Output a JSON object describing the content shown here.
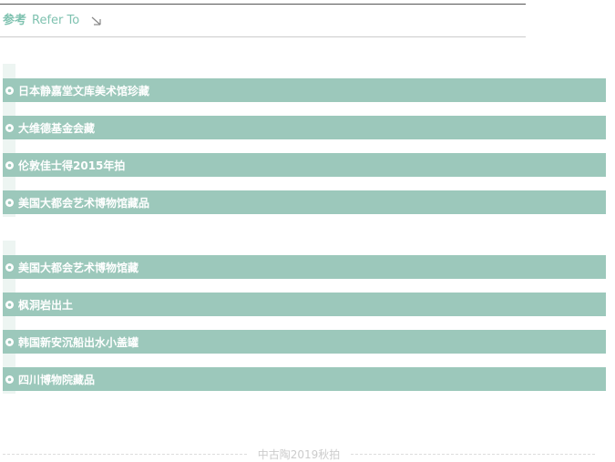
{
  "header": {
    "title_cn": "参考",
    "title_en": "Refer To",
    "accent": "#7fc2b0",
    "arrow_icon": "arrow-down-right-icon"
  },
  "group1": {
    "items": [
      {
        "label": "日本静嘉堂文库美术馆珍藏"
      },
      {
        "label": "大维德基金会藏"
      },
      {
        "label": "伦敦佳士得2015年拍"
      },
      {
        "label": "美国大都会艺术博物馆藏品"
      }
    ]
  },
  "group2": {
    "items": [
      {
        "label": "美国大都会艺术博物馆藏"
      },
      {
        "label": "枫洞岩出土"
      },
      {
        "label": "韩国新安沉船出水小盖罐"
      },
      {
        "label": "四川博物院藏品"
      }
    ]
  },
  "colors": {
    "item_bg": "#9cc8bb",
    "item_text": "#ffffff",
    "strip_bg": "#edf5f2"
  },
  "footer": {
    "text": "中古陶2019秋拍"
  }
}
